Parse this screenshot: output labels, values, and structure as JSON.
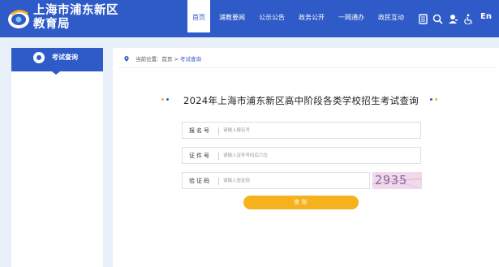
{
  "header": {
    "site_title_line1": "上海市浦东新区",
    "site_title_line2": "教育局",
    "nav": [
      {
        "label": "首页",
        "active": true
      },
      {
        "label": "浦教要闻",
        "active": false
      },
      {
        "label": "公示公告",
        "active": false
      },
      {
        "label": "政务公开",
        "active": false
      },
      {
        "label": "一网通办",
        "active": false
      },
      {
        "label": "政民互动",
        "active": false
      }
    ],
    "tools": [
      "document-icon",
      "search-icon",
      "user-icon",
      "accessibility-icon"
    ],
    "lang_label": "En",
    "brand_color": "#2f5bc8"
  },
  "sidebar": {
    "heading": "考试查询"
  },
  "breadcrumb": {
    "prefix": "当前位置:",
    "home": "首页",
    "sep": ">",
    "current": "考试查询"
  },
  "form": {
    "title": "2024年上海市浦东新区高中阶段各类学校招生考试查询",
    "fields": [
      {
        "label": "报名号",
        "placeholder": "请输入报名号"
      },
      {
        "label": "证件号",
        "placeholder": "请输入证件号码后六位"
      },
      {
        "label": "验证码",
        "placeholder": "请输入验证码"
      }
    ],
    "captcha": "2935",
    "submit_label": "查询",
    "accent_color": "#f6b21c"
  }
}
